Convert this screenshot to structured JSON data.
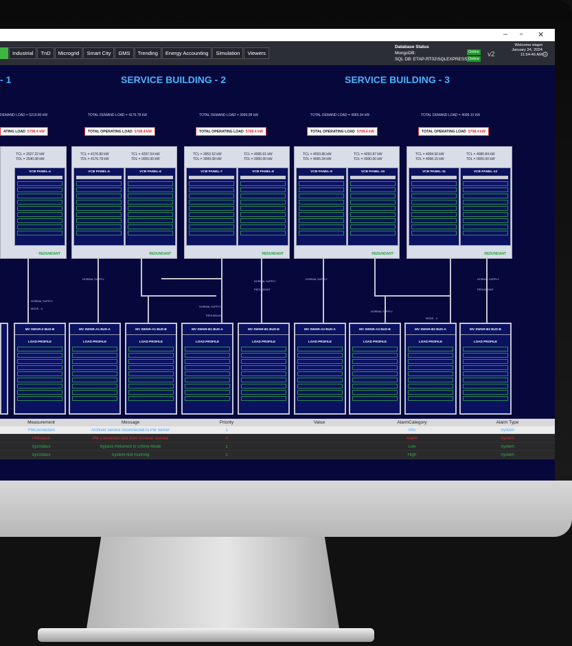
{
  "window": {
    "minimize": "–",
    "maximize": "▫",
    "close": "✕"
  },
  "nav": {
    "tabs": [
      "",
      "Industrial",
      "TnD",
      "Microgrid",
      "Smart City",
      "GMS",
      "Trending",
      "Energy Accounting",
      "Simulation",
      "Viewers"
    ]
  },
  "status": {
    "db_title": "Database Status",
    "mongo": "MongoDB:",
    "sql": "SQL DB: ETAP-RT02\\SQLEXPRESS",
    "online": "Online",
    "version": "v2",
    "welcome": "Welcome etaprt",
    "date": "January 24, 2024",
    "time": "11:54:46 AM"
  },
  "buildings": [
    {
      "title": "- 1"
    },
    {
      "title": "SERVICE BUILDING - 2"
    },
    {
      "title": "SERVICE BUILDING - 3"
    }
  ],
  "demand_loads": [
    "DEMAND LOAD = 5219.80 kW",
    "TOTAL DEMAND LOAD = 4176.78 kW",
    "TOTAL DEMAND LOAD = 3999.08 kW",
    "TOTAL DEMAND LOAD = 4065.34 kW",
    "TOTAL DEMAND LOAD = 4098.10 kW"
  ],
  "op_loads": [
    {
      "label": "ATING LOAD",
      "value": "5708.4 kW"
    },
    {
      "label": "TOTAL OPERATING LOAD",
      "value": "5708.4 kW"
    },
    {
      "label": "TOTAL OPERATING LOAD",
      "value": "5708.4 kW"
    },
    {
      "label": "TOTAL OPERATING LOAD",
      "value": "5708.4 kW"
    },
    {
      "label": "TOTAL OPERATING LOAD",
      "value": "5708.4 kW"
    }
  ],
  "panels": [
    {
      "tcl_a": "TCL = 2927.22 kW",
      "tdl_a": "TDL = 2540.08 kW",
      "tcl_b": "",
      "tdl_b": "",
      "name_a": "VCB PANEL-4",
      "name_b": "",
      "redundant": "REDUNDANT"
    },
    {
      "tcl_a": "TCL = 4176.80 kW",
      "tdl_a": "TDL = 4176.78 kW",
      "tcl_b": "TCL = 4207.54 kW",
      "tdl_b": "TDL = 0000.00 kW",
      "name_a": "VCB PANEL-5",
      "name_b": "VCB PANEL-6",
      "redundant": "REDUNDANT"
    },
    {
      "tcl_a": "TCL = 3953.52 kW",
      "tdl_a": "TDL = 3999.08 kW",
      "tcl_b": "TCL = 4095.01 kW",
      "tdl_b": "TDL = 0000.00 kW",
      "name_a": "VCB PANEL-7",
      "name_b": "VCB PANEL-8",
      "redundant": "REDUNDANT"
    },
    {
      "tcl_a": "TCL = 4003.85 kW",
      "tdl_a": "TDL = 4065.34 kW",
      "tcl_b": "TCL = 4093.87 kW",
      "tdl_b": "TDL = 0000.00 kW",
      "name_a": "VCB PANEL-9",
      "name_b": "VCB PANEL-10",
      "redundant": "REDUNDANT"
    },
    {
      "tcl_a": "TCL = 4094.50 kW",
      "tdl_a": "TDL = 4098.10 kW",
      "tcl_b": "TCL = 4080.84 kW",
      "tdl_b": "TDL = 0000.00 kW",
      "name_a": "VCB PANEL-11",
      "name_b": "VCB PANEL-12",
      "redundant": "REDUNDANT"
    }
  ],
  "buses": [
    "MV SWGR-Z BUS-B",
    "MV SWGR-A1 BUS-A",
    "MV SWGR-A1 BUS-B",
    "MV SWGR-B1 BUS-A",
    "MV SWGR-B1 BUS-B",
    "MV SWGR-A2 BUS-A",
    "MV SWGR-A2 BUS-B",
    "MV SWGR-B2 BUS-A",
    "MV SWGR-B2 BUS-B"
  ],
  "load_profile": "LOAD PROFILE",
  "wire_labels": {
    "normal": "NORMAL SUPPLY",
    "mode4": "MODE - 4",
    "redundant": "REDUNDANT"
  },
  "alarm": {
    "headers": [
      "Measurement",
      "Message",
      "Priority",
      "Value",
      "AlarmCategory",
      "Alarm Type"
    ],
    "rows": [
      {
        "measurement": "PMConnection",
        "message": "Archiver service reconnected to PM Server",
        "priority": "1",
        "value": "",
        "category": "Info",
        "type": "System",
        "color": "#4ba3ff",
        "bg": "#ececec"
      },
      {
        "measurement": "PMStatus",
        "message": "PM Connection lost from Archiver Service",
        "priority": "0",
        "value": "",
        "category": "Alarm",
        "type": "System",
        "color": "#e02828",
        "bg": "#2a2a2c"
      },
      {
        "measurement": "SysStatus",
        "message": "Bypass Returned to Online Mode",
        "priority": "1",
        "value": "",
        "category": "Low",
        "type": "System",
        "color": "#32b24a",
        "bg": "#2a2a2c"
      },
      {
        "measurement": "SysStatus",
        "message": "System Not Running",
        "priority": "2",
        "value": "",
        "category": "High",
        "type": "System",
        "color": "#32b24a",
        "bg": "#2a2a2c"
      }
    ]
  }
}
